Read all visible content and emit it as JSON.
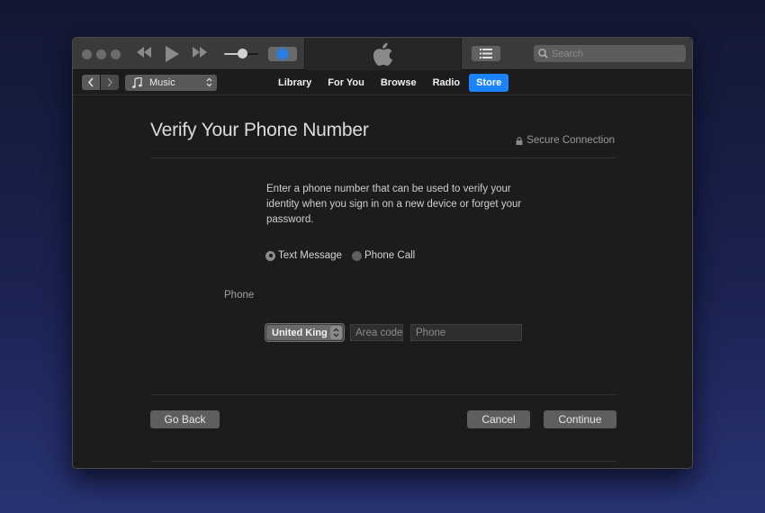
{
  "toolbar": {
    "window_controls": [
      "close",
      "minimize",
      "zoom"
    ],
    "playback": {
      "rewind_icon": "rewind-icon",
      "play_icon": "play-icon",
      "fast_forward_icon": "fast-forward-icon"
    },
    "volume_level": 0.5,
    "airplay_icon": "airplay-icon",
    "lcd_icon": "apple-logo-icon",
    "list_icon": "list-icon",
    "search": {
      "placeholder": "Search",
      "value": ""
    }
  },
  "navbar": {
    "back_icon": "chevron-left-icon",
    "forward_icon": "chevron-right-icon",
    "media_kind": {
      "icon": "music-note-icon",
      "label": "Music"
    },
    "tabs": [
      {
        "label": "Library",
        "active": false
      },
      {
        "label": "For You",
        "active": false
      },
      {
        "label": "Browse",
        "active": false
      },
      {
        "label": "Radio",
        "active": false
      },
      {
        "label": "Store",
        "active": true
      }
    ]
  },
  "page": {
    "title": "Verify Your Phone Number",
    "secure_label": "Secure Connection",
    "intro": "Enter a phone number that can be used to verify your identity when you sign in on a new device or forget your password.",
    "method_options": [
      {
        "label": "Text Message",
        "selected": true
      },
      {
        "label": "Phone Call",
        "selected": false
      }
    ],
    "phone_label": "Phone",
    "country": "United Kingdom",
    "area_code": {
      "placeholder": "Area code",
      "value": ""
    },
    "phone": {
      "placeholder": "Phone",
      "value": ""
    },
    "buttons": {
      "go_back": "Go Back",
      "cancel": "Cancel",
      "continue": "Continue"
    }
  },
  "colors": {
    "accent": "#1a84ff",
    "background_top": "#121833",
    "background_bottom": "#283372",
    "window_bg": "#1c1c1c"
  }
}
